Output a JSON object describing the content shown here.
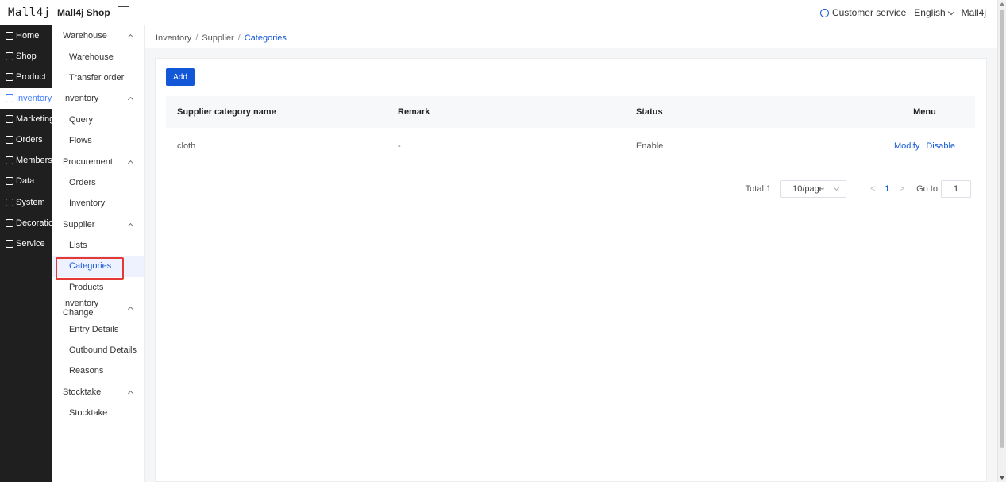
{
  "header": {
    "logo": "Mall4j",
    "shop_name": "Mall4j Shop",
    "customer_service": "Customer service",
    "language": "English",
    "user": "Mall4j"
  },
  "primary_nav": [
    {
      "label": "Home",
      "icon": "home-icon"
    },
    {
      "label": "Shop",
      "icon": "shop-icon"
    },
    {
      "label": "Product",
      "icon": "product-icon"
    },
    {
      "label": "Inventory",
      "icon": "inventory-icon",
      "active": true
    },
    {
      "label": "Marketing",
      "icon": "marketing-icon"
    },
    {
      "label": "Orders",
      "icon": "orders-icon"
    },
    {
      "label": "Members",
      "icon": "members-icon"
    },
    {
      "label": "Data",
      "icon": "data-icon"
    },
    {
      "label": "System",
      "icon": "system-icon"
    },
    {
      "label": "Decoration",
      "icon": "decoration-icon"
    },
    {
      "label": "Service",
      "icon": "service-icon"
    }
  ],
  "secondary_nav": {
    "warehouse": {
      "label": "Warehouse",
      "items": [
        "Warehouse",
        "Transfer order"
      ]
    },
    "inventory": {
      "label": "Inventory",
      "items": [
        "Query",
        "Flows"
      ]
    },
    "procurement": {
      "label": "Procurement",
      "items": [
        "Orders",
        "Inventory"
      ]
    },
    "supplier": {
      "label": "Supplier",
      "items": [
        "Lists",
        "Categories",
        "Products"
      ]
    },
    "inventory_change": {
      "label": "Inventory Change",
      "items": [
        "Entry Details",
        "Outbound Details",
        "Reasons"
      ]
    },
    "stocktake": {
      "label": "Stocktake",
      "items": [
        "Stocktake"
      ]
    }
  },
  "breadcrumb": [
    "Inventory",
    "Supplier",
    "Categories"
  ],
  "toolbar": {
    "add_label": "Add"
  },
  "table": {
    "headers": [
      "Supplier category name",
      "Remark",
      "Status",
      "Menu"
    ],
    "rows": [
      {
        "name": "cloth",
        "remark": "-",
        "status": "Enable",
        "actions": [
          "Modify",
          "Disable"
        ]
      }
    ]
  },
  "pagination": {
    "total": "Total 1",
    "page_size": "10/page",
    "current_page": "1",
    "goto_label": "Go to",
    "goto_value": "1"
  },
  "colors": {
    "accent": "#1257d8",
    "nav_bg": "#1f1f1f",
    "highlight": "#e53935"
  }
}
